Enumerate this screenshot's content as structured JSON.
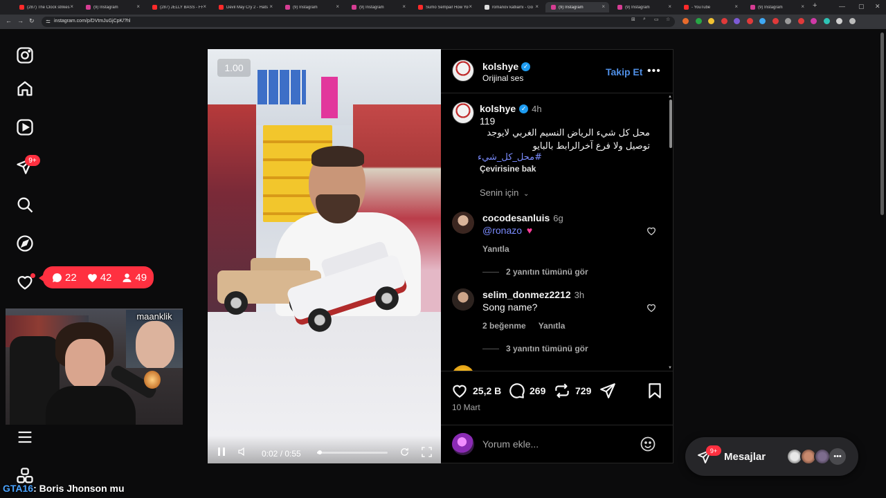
{
  "browser": {
    "tabs": [
      {
        "title": "(287) The Clock strikes",
        "color": "#ff2a2a",
        "active": false
      },
      {
        "title": "(9) Instagram",
        "color": "#d63d93",
        "active": false
      },
      {
        "title": "(287) JELLY BASS - FRE",
        "color": "#ff2a2a",
        "active": false
      },
      {
        "title": "Devil May Cry 2 - Hats",
        "color": "#ff2a2a",
        "active": false
      },
      {
        "title": "(9) Instagram",
        "color": "#d63d93",
        "active": false
      },
      {
        "title": "(9) Instagram",
        "color": "#d63d93",
        "active": false
      },
      {
        "title": "Sumo Sempai! How You",
        "color": "#ff2a2a",
        "active": false
      },
      {
        "title": "romanov katliamı - Go",
        "color": "#dddddd",
        "active": false
      },
      {
        "title": "(9) Instagram",
        "color": "#d63d93",
        "active": true
      },
      {
        "title": "(9) Instagram",
        "color": "#d63d93",
        "active": false
      },
      {
        "title": "- YouTube",
        "color": "#ff2a2a",
        "active": false
      },
      {
        "title": "(9) Instagram",
        "color": "#d63d93",
        "active": false
      }
    ],
    "new_tab_label": "+",
    "url": "instagram.com/p/DVtmJuGjCpK/?hl"
  },
  "sidebar": {
    "notification_badge": "9+",
    "activity": {
      "comments": "22",
      "likes": "42",
      "follows": "49"
    }
  },
  "stream": {
    "pip_name": "maanklik",
    "chat_user": "GTA16",
    "chat_message": ": Boris Jhonson mu"
  },
  "video": {
    "speed": "1.00",
    "time": "0:02 / 0:55",
    "progress": 0.04
  },
  "post": {
    "author": "kolshye",
    "audio": "Orijinal ses",
    "follow_label": "Takip Et",
    "caption": {
      "time": "4h",
      "line1": "119",
      "line2": "محل كل شيء الرياض النسيم الغربي لايوجد",
      "line3": "توصيل ولا فرع آخرالرابط بالبايو",
      "hashtag": "#محل_كل_شيء",
      "translate": "Çevirisine bak"
    },
    "for_you": "Senin için",
    "comments": [
      {
        "user": "cocodesanluis",
        "time": "6g",
        "mention": "@ronazo",
        "text": "",
        "likes": "",
        "reply": "Yanıtla",
        "view_replies": "2 yanıtın tümünü gör"
      },
      {
        "user": "selim_donmez2212",
        "time": "3h",
        "mention": "",
        "text": "Song name?",
        "likes": "2 beğenme",
        "reply": "Yanıtla",
        "view_replies": "3 yanıtın tümünü gör"
      }
    ],
    "stats": {
      "likes": "25,2 B",
      "comments": "269",
      "reposts": "729"
    },
    "date": "10 Mart",
    "comment_placeholder": "Yorum ekle..."
  },
  "messages_dock": {
    "badge": "9+",
    "label": "Mesajlar"
  }
}
